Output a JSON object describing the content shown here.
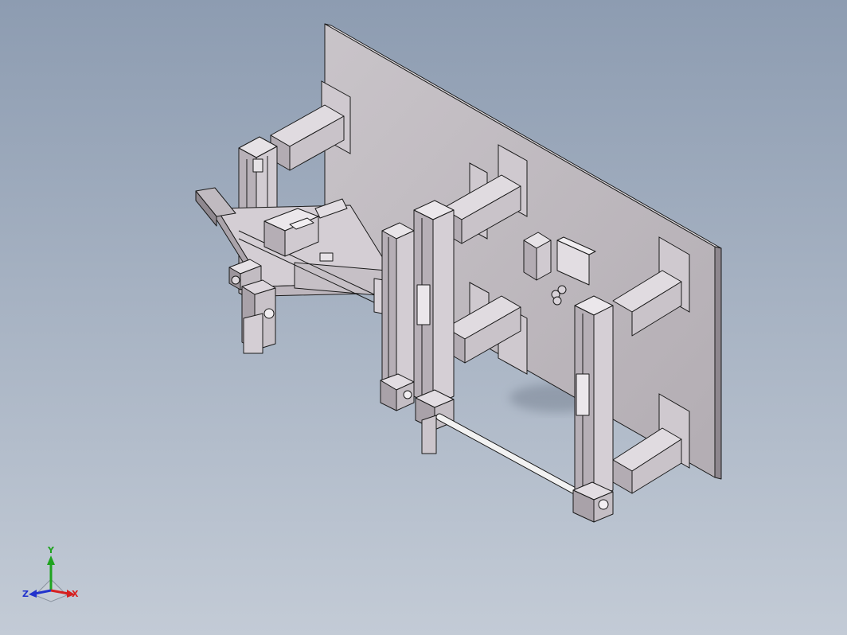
{
  "view": {
    "background_top": "#8d9cb1",
    "background_bottom": "#c3cbd6",
    "part_face_light": "#d8d3d8",
    "part_face_mid": "#bfb8bf",
    "part_face_dark": "#9a929a",
    "edge_color": "#1a1a1a",
    "rod_color": "#f2f2f2"
  },
  "triad": {
    "x_label": "X",
    "y_label": "Y",
    "z_label": "Z",
    "x_color": "#d62020",
    "y_color": "#1fa31f",
    "z_color": "#2233cc"
  }
}
